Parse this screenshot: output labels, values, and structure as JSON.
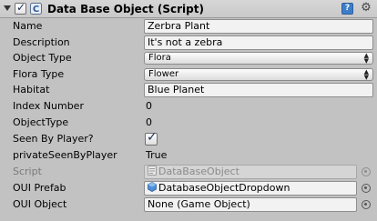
{
  "component": {
    "title": "Data Base Object (Script)",
    "enabled": true,
    "icons": [
      "foldout-arrow-icon",
      "script-icon",
      "help-icon",
      "gear-icon"
    ]
  },
  "fields": {
    "name": {
      "label": "Name",
      "value": "Zerbra Plant"
    },
    "description": {
      "label": "Description",
      "value": "It's not a zebra"
    },
    "object_type": {
      "label": "Object Type",
      "value": "Flora"
    },
    "flora_type": {
      "label": "Flora Type",
      "value": "Flower"
    },
    "habitat": {
      "label": "Habitat",
      "value": "Blue Planet"
    },
    "index_number": {
      "label": "Index Number",
      "value": "0"
    },
    "object_type_int": {
      "label": "ObjectType",
      "value": "0"
    },
    "seen_by_player": {
      "label": "Seen By Player?",
      "checked": true
    },
    "private_seen_by_player": {
      "label": "privateSeenByPlayer",
      "value": "True"
    },
    "script": {
      "label": "Script",
      "value": "DataBaseObject"
    },
    "oui_prefab": {
      "label": "OUI Prefab",
      "value": "DatabaseObjectDropdown"
    },
    "oui_object": {
      "label": "OUI Object",
      "value": "None (Game Object)"
    }
  }
}
